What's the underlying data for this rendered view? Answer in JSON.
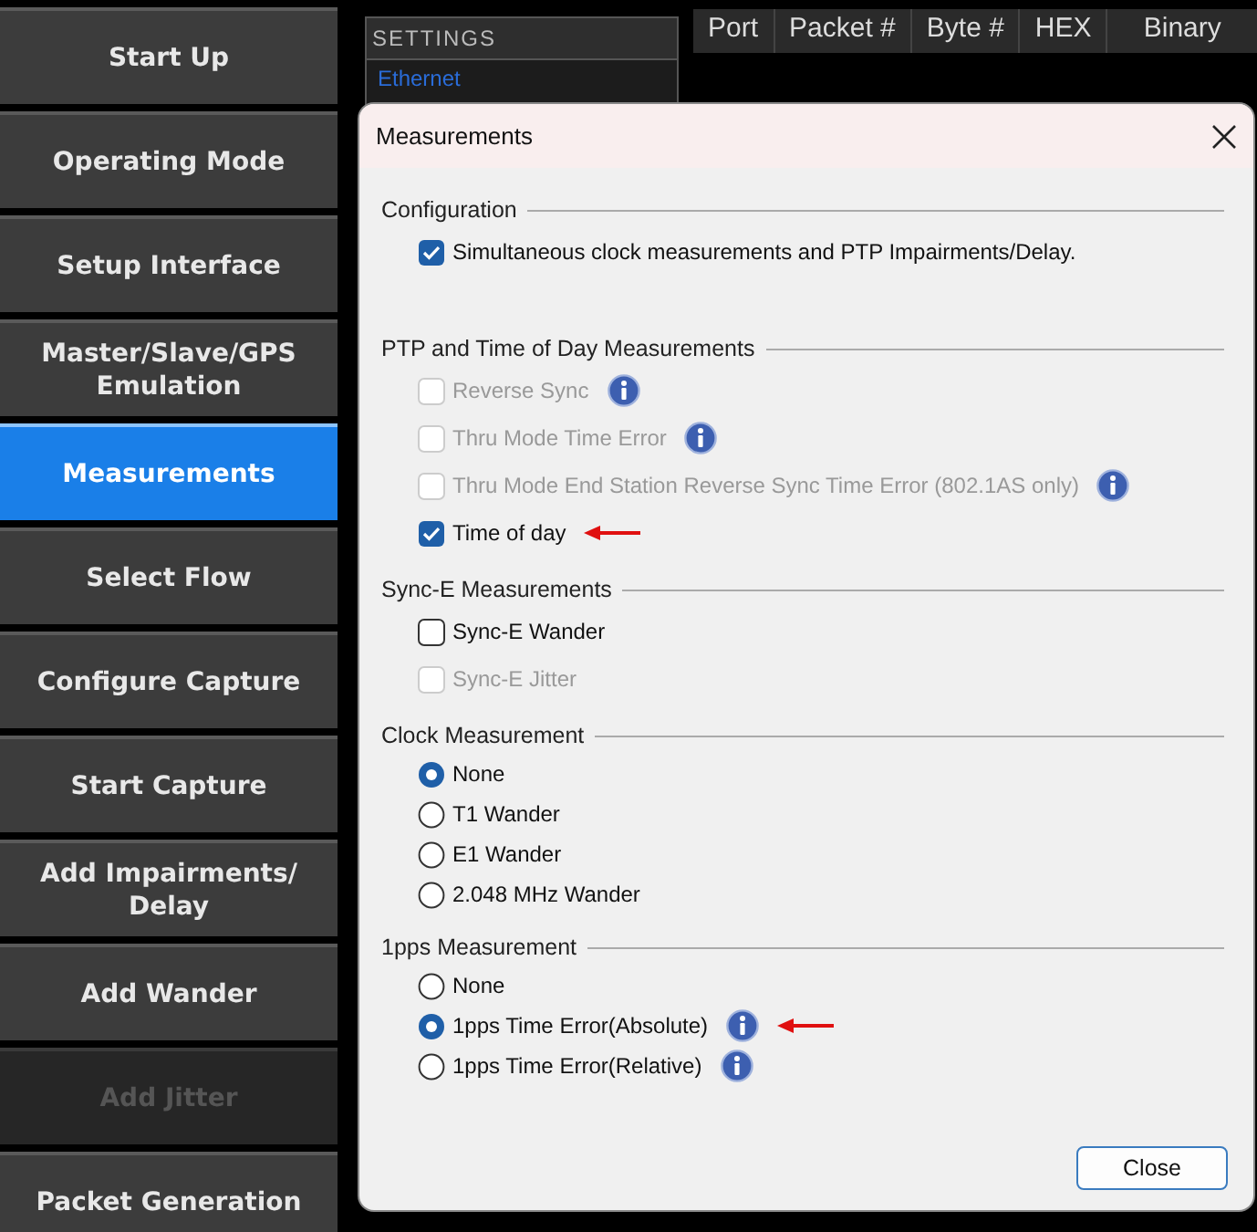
{
  "sidebar": {
    "items": [
      {
        "label": "Start Up",
        "selected": false,
        "disabled": false
      },
      {
        "label": "Operating Mode",
        "selected": false,
        "disabled": false
      },
      {
        "label": "Setup Interface",
        "selected": false,
        "disabled": false
      },
      {
        "label": "Master/Slave/GPS Emulation",
        "selected": false,
        "disabled": false
      },
      {
        "label": "Measurements",
        "selected": true,
        "disabled": false
      },
      {
        "label": "Select Flow",
        "selected": false,
        "disabled": false
      },
      {
        "label": "Configure Capture",
        "selected": false,
        "disabled": false
      },
      {
        "label": "Start Capture",
        "selected": false,
        "disabled": false
      },
      {
        "label": "Add Impairments/ Delay",
        "selected": false,
        "disabled": false
      },
      {
        "label": "Add Wander",
        "selected": false,
        "disabled": false
      },
      {
        "label": "Add Jitter",
        "selected": false,
        "disabled": true
      },
      {
        "label": "Packet Generation",
        "selected": false,
        "disabled": false
      }
    ]
  },
  "settings_panel": {
    "title": "SETTINGS",
    "items": [
      "Ethernet"
    ]
  },
  "table": {
    "columns": [
      "Port",
      "Packet #",
      "Byte #",
      "HEX",
      "Binary"
    ]
  },
  "dialog": {
    "title": "Measurements",
    "groups": [
      {
        "title": "Configuration",
        "items": [
          {
            "kind": "checkbox",
            "label": "Simultaneous clock measurements and PTP Impairments/Delay.",
            "checked": true,
            "disabled": false,
            "info": false,
            "marked": false
          }
        ]
      },
      {
        "title": "PTP and Time of Day Measurements",
        "items": [
          {
            "kind": "checkbox",
            "label": "Reverse Sync",
            "checked": false,
            "disabled": true,
            "info": true,
            "marked": false
          },
          {
            "kind": "checkbox",
            "label": "Thru Mode Time Error",
            "checked": false,
            "disabled": true,
            "info": true,
            "marked": false
          },
          {
            "kind": "checkbox",
            "label": "Thru Mode End Station Reverse Sync Time Error (802.1AS only)",
            "checked": false,
            "disabled": true,
            "info": true,
            "marked": false
          },
          {
            "kind": "checkbox",
            "label": "Time of day",
            "checked": true,
            "disabled": false,
            "info": false,
            "marked": true
          }
        ]
      },
      {
        "title": "Sync-E Measurements",
        "items": [
          {
            "kind": "checkbox",
            "label": "Sync-E Wander",
            "checked": false,
            "disabled": false,
            "info": false,
            "marked": false
          },
          {
            "kind": "checkbox",
            "label": "Sync-E Jitter",
            "checked": false,
            "disabled": true,
            "info": false,
            "marked": false
          }
        ]
      },
      {
        "title": "Clock Measurement",
        "items": [
          {
            "kind": "radio",
            "label": "None",
            "selected": true,
            "disabled": false,
            "info": false,
            "marked": false
          },
          {
            "kind": "radio",
            "label": "T1 Wander",
            "selected": false,
            "disabled": false,
            "info": false,
            "marked": false
          },
          {
            "kind": "radio",
            "label": "E1 Wander",
            "selected": false,
            "disabled": false,
            "info": false,
            "marked": false
          },
          {
            "kind": "radio",
            "label": "2.048 MHz Wander",
            "selected": false,
            "disabled": false,
            "info": false,
            "marked": false
          }
        ]
      },
      {
        "title": "1pps Measurement",
        "items": [
          {
            "kind": "radio",
            "label": "None",
            "selected": false,
            "disabled": false,
            "info": false,
            "marked": false
          },
          {
            "kind": "radio",
            "label": "1pps Time Error(Absolute)",
            "selected": true,
            "disabled": false,
            "info": true,
            "marked": true
          },
          {
            "kind": "radio",
            "label": "1pps Time Error(Relative)",
            "selected": false,
            "disabled": false,
            "info": true,
            "marked": false
          }
        ]
      }
    ],
    "buttons": [
      "Close"
    ]
  }
}
